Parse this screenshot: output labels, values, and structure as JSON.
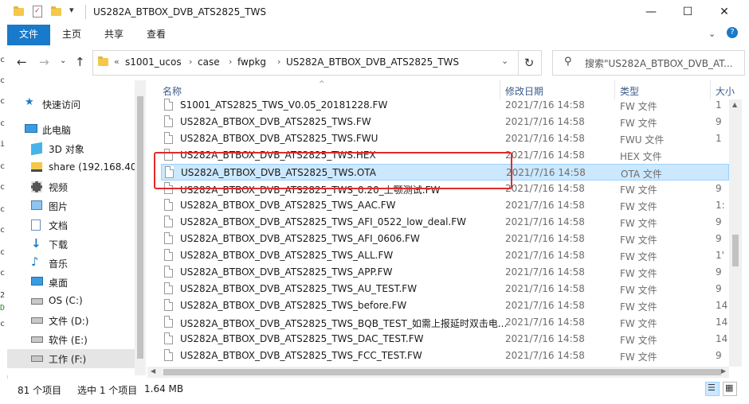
{
  "window": {
    "title": "US282A_BTBOX_DVB_ATS2825_TWS",
    "controls": {
      "minimize": "—",
      "maximize": "☐",
      "close": "✕"
    }
  },
  "ribbon": {
    "tabs": [
      "文件",
      "主页",
      "共享",
      "查看"
    ]
  },
  "address": {
    "overflow": "«",
    "crumbs": [
      "s1001_ucos",
      "case",
      "fwpkg",
      "US282A_BTBOX_DVB_ATS2825_TWS"
    ]
  },
  "search": {
    "placeholder": "搜索\"US282A_BTBOX_DVB_AT..."
  },
  "sidebar": {
    "items": [
      {
        "label": "快速访问",
        "icon": "star-icon"
      },
      {
        "label": "此电脑",
        "icon": "computer-icon"
      },
      {
        "label": "3D 对象",
        "icon": "cube-icon"
      },
      {
        "label": "share (192.168.40.",
        "icon": "network-folder-icon"
      },
      {
        "label": "视频",
        "icon": "video-icon"
      },
      {
        "label": "图片",
        "icon": "picture-icon"
      },
      {
        "label": "文档",
        "icon": "document-icon"
      },
      {
        "label": "下载",
        "icon": "download-icon"
      },
      {
        "label": "音乐",
        "icon": "music-icon"
      },
      {
        "label": "桌面",
        "icon": "desktop-icon"
      },
      {
        "label": "OS (C:)",
        "icon": "drive-icon"
      },
      {
        "label": "文件 (D:)",
        "icon": "drive-icon"
      },
      {
        "label": "软件 (E:)",
        "icon": "drive-icon"
      },
      {
        "label": "工作 (F:)",
        "icon": "drive-icon"
      }
    ],
    "selected": "工作 (F:)"
  },
  "list": {
    "columns": {
      "name": "名称",
      "date": "修改日期",
      "type": "类型",
      "size": "大小"
    },
    "rows": [
      {
        "name": "S1001_ATS2825_TWS_V0.05_20181228.FW",
        "date": "2021/7/16 14:58",
        "type": "FW 文件",
        "size": "1"
      },
      {
        "name": "US282A_BTBOX_DVB_ATS2825_TWS.FW",
        "date": "2021/7/16 14:58",
        "type": "FW 文件",
        "size": "9"
      },
      {
        "name": "US282A_BTBOX_DVB_ATS2825_TWS.FWU",
        "date": "2021/7/16 14:58",
        "type": "FWU 文件",
        "size": "1"
      },
      {
        "name": "US282A_BTBOX_DVB_ATS2825_TWS.HEX",
        "date": "2021/7/16 14:58",
        "type": "HEX 文件",
        "size": ""
      },
      {
        "name": "US282A_BTBOX_DVB_ATS2825_TWS.OTA",
        "date": "2021/7/16 14:58",
        "type": "OTA 文件",
        "size": ""
      },
      {
        "name": "US282A_BTBOX_DVB_ATS2825_TWS_0.20_上颚测试.FW",
        "date": "2021/7/16 14:58",
        "type": "FW 文件",
        "size": "9"
      },
      {
        "name": "US282A_BTBOX_DVB_ATS2825_TWS_AAC.FW",
        "date": "2021/7/16 14:58",
        "type": "FW 文件",
        "size": "1:"
      },
      {
        "name": "US282A_BTBOX_DVB_ATS2825_TWS_AFI_0522_low_deal.FW",
        "date": "2021/7/16 14:58",
        "type": "FW 文件",
        "size": "9"
      },
      {
        "name": "US282A_BTBOX_DVB_ATS2825_TWS_AFI_0606.FW",
        "date": "2021/7/16 14:58",
        "type": "FW 文件",
        "size": "9"
      },
      {
        "name": "US282A_BTBOX_DVB_ATS2825_TWS_ALL.FW",
        "date": "2021/7/16 14:58",
        "type": "FW 文件",
        "size": "1'"
      },
      {
        "name": "US282A_BTBOX_DVB_ATS2825_TWS_APP.FW",
        "date": "2021/7/16 14:58",
        "type": "FW 文件",
        "size": "9"
      },
      {
        "name": "US282A_BTBOX_DVB_ATS2825_TWS_AU_TEST.FW",
        "date": "2021/7/16 14:58",
        "type": "FW 文件",
        "size": "9"
      },
      {
        "name": "US282A_BTBOX_DVB_ATS2825_TWS_before.FW",
        "date": "2021/7/16 14:58",
        "type": "FW 文件",
        "size": "14"
      },
      {
        "name": "US282A_BTBOX_DVB_ATS2825_TWS_BQB_TEST_如需上报延时双击电...",
        "date": "2021/7/16 14:58",
        "type": "FW 文件",
        "size": "14"
      },
      {
        "name": "US282A_BTBOX_DVB_ATS2825_TWS_DAC_TEST.FW",
        "date": "2021/7/16 14:58",
        "type": "FW 文件",
        "size": "14"
      },
      {
        "name": "US282A_BTBOX_DVB_ATS2825_TWS_FCC_TEST.FW",
        "date": "2021/7/16 14:58",
        "type": "FW 文件",
        "size": "9"
      }
    ],
    "selected_index": 4
  },
  "status": {
    "count": "81 个项目",
    "selection": "选中 1 个项目",
    "size": "1.64 MB"
  },
  "colors": {
    "accent": "#1979ca",
    "selection": "#cce8ff",
    "highlight_box": "#e02b2b"
  }
}
